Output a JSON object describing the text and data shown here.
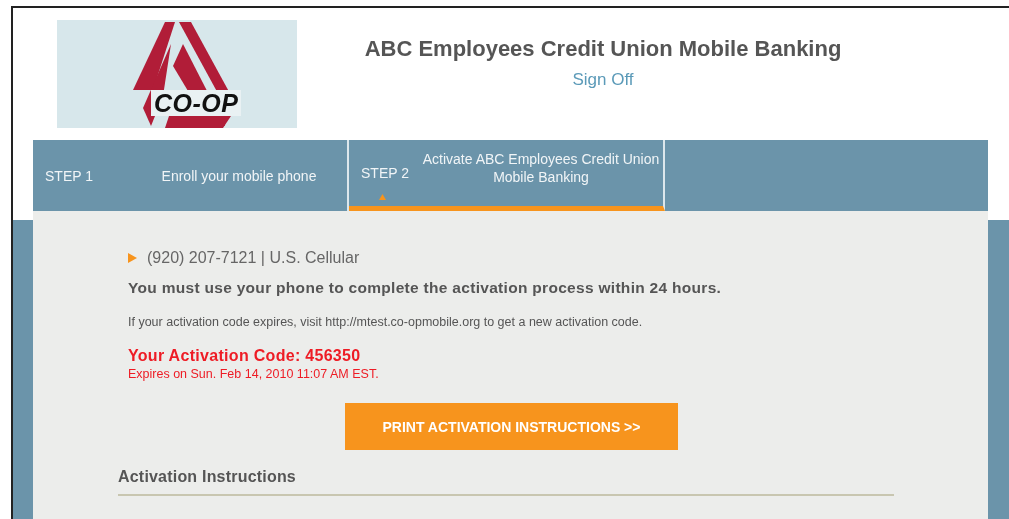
{
  "header": {
    "logo_text": "CO-OP",
    "title": "ABC Employees Credit Union Mobile Banking",
    "sign_off": "Sign Off"
  },
  "steps": [
    {
      "step": "STEP 1",
      "label": "Enroll your mobile phone",
      "selected": false
    },
    {
      "step": "STEP 2",
      "label": "Activate ABC Employees Credit Union Mobile Banking",
      "selected": true
    }
  ],
  "content": {
    "phone": "(920) 207-7121 | U.S. Cellular",
    "notice": "You must use your phone to complete the activation process within 24 hours.",
    "expiry_help": "If your activation code expires, visit http://mtest.co-opmobile.org to get a new activation code.",
    "activation_code": "Your Activation Code: 456350",
    "expires": "Expires on Sun. Feb 14, 2010 11:07 AM EST.",
    "print_button": "PRINT ACTIVATION INSTRUCTIONS >>",
    "section_heading": "Activation Instructions"
  }
}
